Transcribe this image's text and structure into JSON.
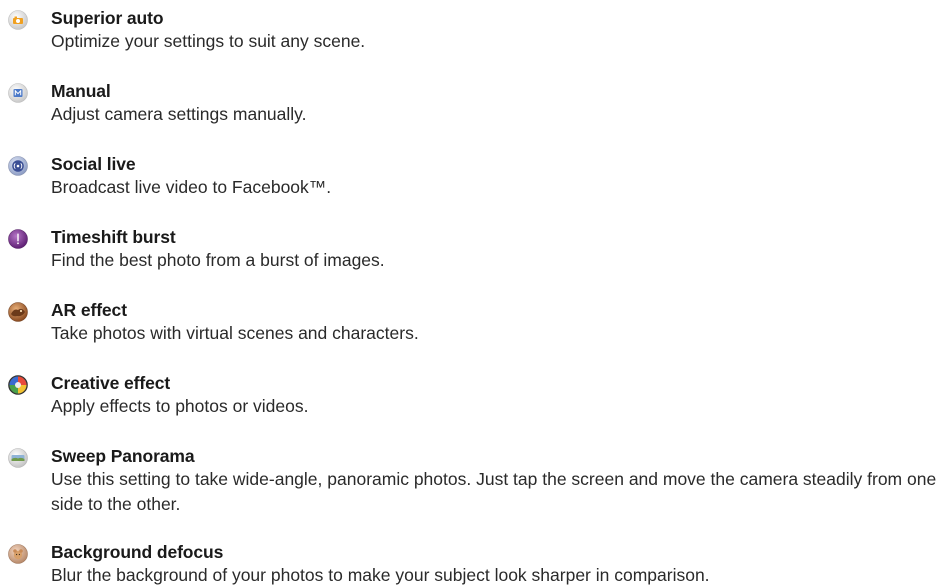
{
  "modes": [
    {
      "icon": "superior-auto-icon",
      "title": "Superior auto",
      "description": "Optimize your settings to suit any scene."
    },
    {
      "icon": "manual-icon",
      "title": "Manual",
      "description": "Adjust camera settings manually."
    },
    {
      "icon": "social-live-icon",
      "title": "Social live",
      "description": "Broadcast live video to Facebook™."
    },
    {
      "icon": "timeshift-burst-icon",
      "title": "Timeshift burst",
      "description": "Find the best photo from a burst of images."
    },
    {
      "icon": "ar-effect-icon",
      "title": "AR effect",
      "description": "Take photos with virtual scenes and characters."
    },
    {
      "icon": "creative-effect-icon",
      "title": "Creative effect",
      "description": "Apply effects to photos or videos."
    },
    {
      "icon": "sweep-panorama-icon",
      "title": "Sweep Panorama",
      "description": "Use this setting to take wide-angle, panoramic photos. Just tap the screen and move the camera steadily from one side to the other."
    },
    {
      "icon": "background-defocus-icon",
      "title": "Background defocus",
      "description": "Blur the background of your photos to make your subject look sharper in comparison."
    }
  ]
}
